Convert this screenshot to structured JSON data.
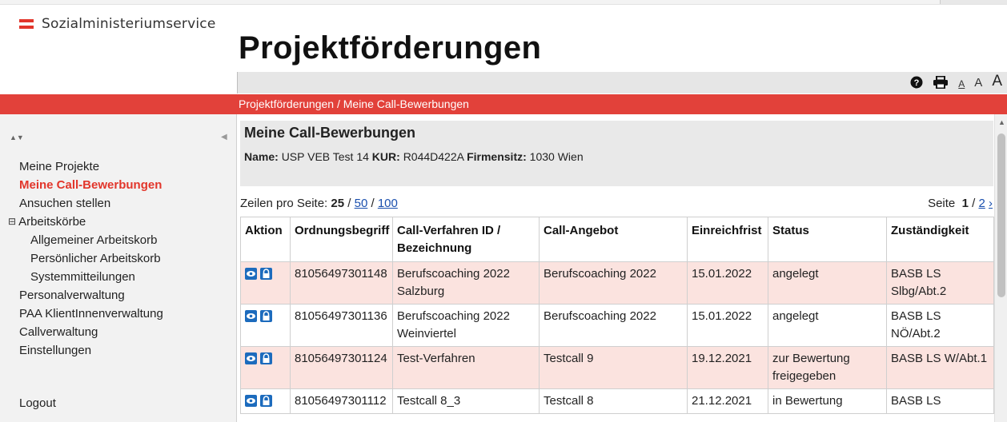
{
  "brand": {
    "name": "Sozialministeriumservice"
  },
  "page": {
    "title": "Projektförderungen"
  },
  "toolbar": {
    "font_small": "A",
    "font_mid": "A",
    "font_large": "A"
  },
  "breadcrumb": "Projektförderungen / Meine Call-Bewerbungen",
  "sidebar": {
    "sort_arrows": "▲▼",
    "collapse_arrow": "◀",
    "items": [
      {
        "label": "Meine Projekte"
      },
      {
        "label": "Meine Call-Bewerbungen"
      },
      {
        "label": "Ansuchen stellen"
      },
      {
        "label": "Arbeitskörbe",
        "toggle": "⊟"
      },
      {
        "label": "Allgemeiner Arbeitskorb"
      },
      {
        "label": "Persönlicher Arbeitskorb"
      },
      {
        "label": "Systemmitteilungen"
      },
      {
        "label": "Personalverwaltung"
      },
      {
        "label": "PAA KlientInnenverwaltung"
      },
      {
        "label": "Callverwaltung"
      },
      {
        "label": "Einstellungen"
      }
    ],
    "logout": "Logout"
  },
  "main": {
    "section_title": "Meine Call-Bewerbungen",
    "info": {
      "name_label": "Name:",
      "name_value": "USP VEB Test 14",
      "kur_label": "KUR:",
      "kur_value": "R044D422A",
      "sitz_label": "Firmensitz:",
      "sitz_value": "1030 Wien"
    },
    "per_page": {
      "label": "Zeilen pro Seite:",
      "current": "25",
      "sep1": "/",
      "opt1": "50",
      "sep2": "/",
      "opt2": "100"
    },
    "pager": {
      "label": "Seite",
      "current": "1",
      "sep": "/",
      "next_page": "2",
      "next_arrow": "›"
    },
    "table": {
      "headers": [
        "Aktion",
        "Ordnungsbegriff",
        "Call-Verfahren ID / Bezeichnung",
        "Call-Angebot",
        "Einreichfrist",
        "Status",
        "Zuständigkeit"
      ],
      "rows": [
        {
          "ordnungsbegriff": "81056497301148",
          "verfahren": "Berufscoaching 2022 Salzburg",
          "angebot": "Berufscoaching 2022",
          "frist": "15.01.2022",
          "status": "angelegt",
          "zustaendigkeit": "BASB LS Slbg/Abt.2"
        },
        {
          "ordnungsbegriff": "81056497301136",
          "verfahren": "Berufscoaching 2022 Weinviertel",
          "angebot": "Berufscoaching 2022",
          "frist": "15.01.2022",
          "status": "angelegt",
          "zustaendigkeit": "BASB LS NÖ/Abt.2"
        },
        {
          "ordnungsbegriff": "81056497301124",
          "verfahren": "Test-Verfahren",
          "angebot": "Testcall 9",
          "frist": "19.12.2021",
          "status": "zur Bewertung freigegeben",
          "zustaendigkeit": "BASB LS W/Abt.1"
        },
        {
          "ordnungsbegriff": "81056497301112",
          "verfahren": "Testcall 8_3",
          "angebot": "Testcall 8",
          "frist": "21.12.2021",
          "status": "in Bewertung",
          "zustaendigkeit": "BASB LS"
        }
      ]
    }
  },
  "colors": {
    "accent_red": "#e2413a",
    "row_highlight": "#fbe3df",
    "link_blue": "#1a4fae",
    "icon_blue": "#1c6bbd"
  },
  "icons": [
    "help-icon",
    "print-icon",
    "view-icon",
    "lock-icon"
  ]
}
